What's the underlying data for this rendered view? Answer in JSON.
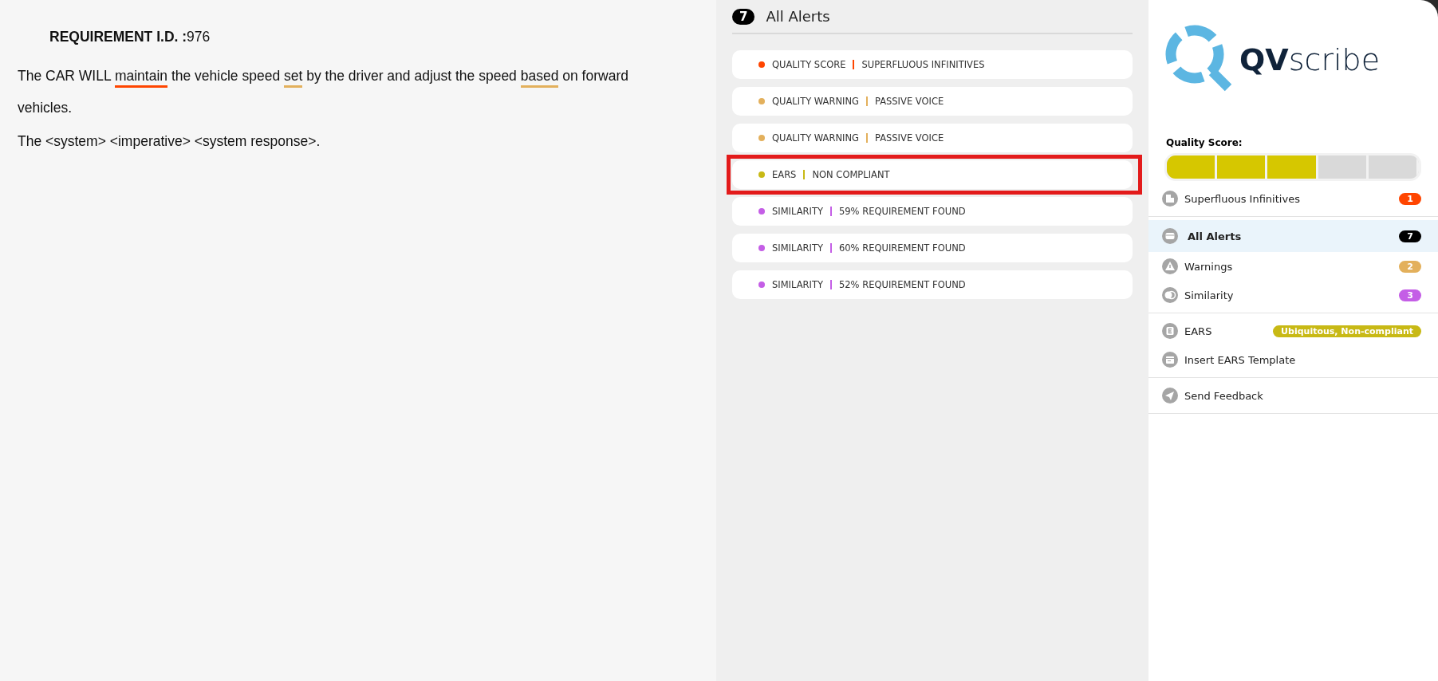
{
  "requirement": {
    "label": "REQUIREMENT I.D. :",
    "id": "976",
    "sentence": [
      {
        "text": "The CAR WILL "
      },
      {
        "text": "maintain",
        "color": "#ff4500"
      },
      {
        "text": " the vehicle speed "
      },
      {
        "text": "set",
        "color": "#e3b05c"
      },
      {
        "text": " by the driver and adjust the speed "
      },
      {
        "text": "based",
        "color": "#e3b05c"
      },
      {
        "text": " on forward vehicles."
      }
    ],
    "template": "The <system> <imperative> <system response>."
  },
  "alerts_panel": {
    "count": "7",
    "title": "All Alerts",
    "alerts": [
      {
        "category": "QUALITY SCORE",
        "detail": "SUPERFLUOUS INFINITIVES",
        "color": "#ff4500",
        "highlighted": false
      },
      {
        "category": "QUALITY WARNING",
        "detail": "PASSIVE VOICE",
        "color": "#e3b05c",
        "highlighted": false
      },
      {
        "category": "QUALITY WARNING",
        "detail": "PASSIVE VOICE",
        "color": "#e3b05c",
        "highlighted": false
      },
      {
        "category": "EARS",
        "detail": "NON  COMPLIANT",
        "color": "#c8b915",
        "highlighted": true
      },
      {
        "category": "SIMILARITY",
        "detail": "59% REQUIREMENT FOUND",
        "color": "#c45ee6",
        "highlighted": false
      },
      {
        "category": "SIMILARITY",
        "detail": "60% REQUIREMENT FOUND",
        "color": "#c45ee6",
        "highlighted": false
      },
      {
        "category": "SIMILARITY",
        "detail": "52% REQUIREMENT FOUND",
        "color": "#c45ee6",
        "highlighted": false
      }
    ]
  },
  "sidebar": {
    "logo": {
      "bold": "QV",
      "light": "scribe"
    },
    "quality_score": {
      "label": "Quality Score:",
      "level": 0.6
    },
    "groups": [
      [
        {
          "kind": "infinitives",
          "label": "Superfluous Infinitives",
          "badge": "1",
          "color": "#ff4500",
          "selected": false
        }
      ],
      [
        {
          "kind": "alerts",
          "label": "All Alerts",
          "badge": "7",
          "color": "#000000",
          "selected": true
        },
        {
          "kind": "warnings",
          "label": "Warnings",
          "badge": "2",
          "color": "#e3b05c",
          "selected": false
        },
        {
          "kind": "similarity",
          "label": "Similarity",
          "badge": "3",
          "color": "#c45ee6",
          "selected": false
        }
      ],
      [
        {
          "kind": "ears",
          "label": "EARS",
          "badge": "Ubiquitous, Non-compliant",
          "color": "#c8b915",
          "selected": false
        },
        {
          "kind": "template",
          "label": "Insert EARS Template",
          "selected": false
        }
      ],
      [
        {
          "kind": "feedback",
          "label": "Send Feedback",
          "selected": false
        }
      ]
    ]
  }
}
